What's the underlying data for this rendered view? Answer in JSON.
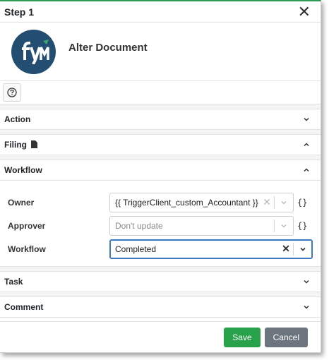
{
  "modal": {
    "title": "Step 1"
  },
  "app": {
    "name": "Alter Document"
  },
  "sections": {
    "action": "Action",
    "filing": "Filing",
    "workflow": "Workflow",
    "task": "Task",
    "comment": "Comment"
  },
  "workflow_form": {
    "owner_label": "Owner",
    "owner_value": "{{ TriggerClient_custom_Accountant }}",
    "approver_label": "Approver",
    "approver_placeholder": "Don't update",
    "workflow_label": "Workflow",
    "workflow_value": "Completed",
    "braces": "{}"
  },
  "footer": {
    "save_label": "Save",
    "cancel_label": "Cancel"
  },
  "colors": {
    "accent": "#2e9b57",
    "logo_bg": "#244d72",
    "save": "#28a24a",
    "cancel": "#6c757d"
  },
  "icons": [
    "close-icon",
    "help-icon",
    "chevron-down-icon",
    "chevron-up-icon",
    "document-icon",
    "clear-icon"
  ]
}
